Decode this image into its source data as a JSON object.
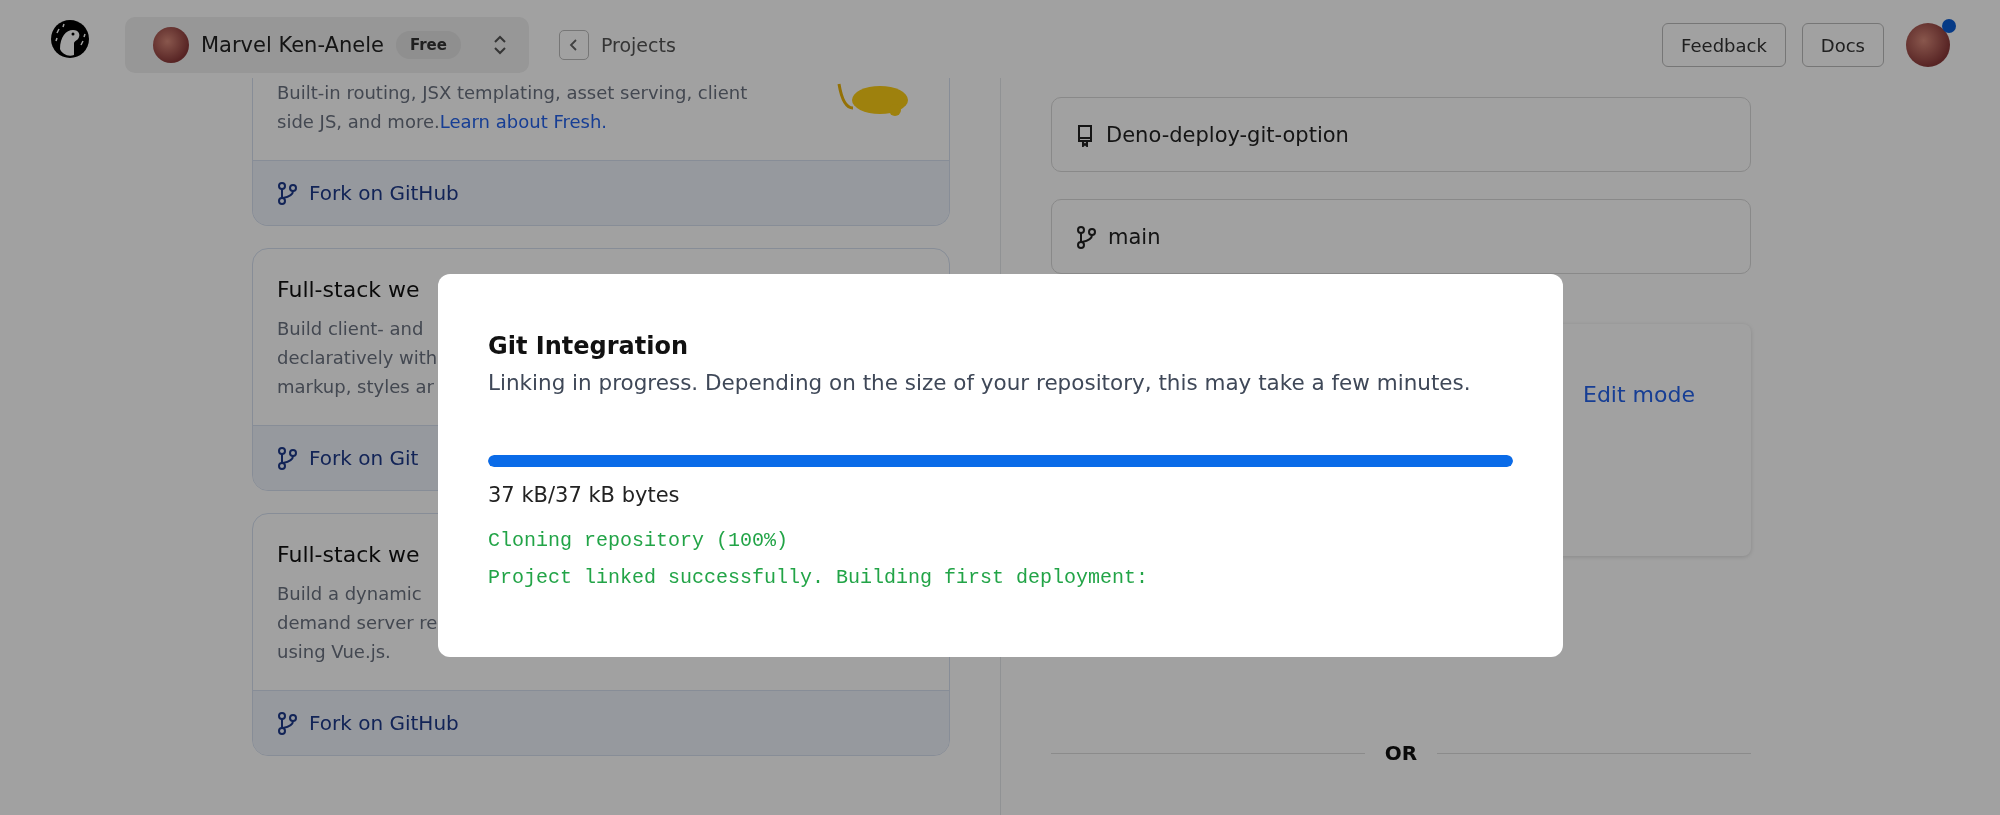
{
  "header": {
    "workspace": {
      "name": "Marvel Ken-Anele",
      "plan": "Free"
    },
    "breadcrumb": "Projects",
    "buttons": [
      "Feedback",
      "Docs"
    ],
    "notification": true
  },
  "templates": [
    {
      "description_lines": [
        "Built-in routing, JSX templating, asset serving, client",
        "side JS, and more."
      ],
      "link": "Learn about Fresh.",
      "action": "Fork on GitHub"
    },
    {
      "title": "Full-stack we",
      "description_lines": [
        "Build client- and",
        "declaratively with",
        "markup, styles ar"
      ],
      "action": "Fork on Git"
    },
    {
      "title": "Full-stack we",
      "description_lines": [
        "Build a dynamic",
        "demand server re",
        "using Vue.js."
      ],
      "action": "Fork on GitHub"
    }
  ],
  "git": {
    "repository": "Deno-deploy-git-option",
    "branch": "main",
    "edit_link": "Edit mode",
    "divider": "OR"
  },
  "modal": {
    "title": "Git Integration",
    "message": "Linking in progress. Depending on the size of your repository, this may take a few minutes.",
    "progress": {
      "level": 1,
      "reading": "37 kB/37 kB bytes"
    },
    "log": [
      "Cloning repository (100%)",
      "Project linked successfully. Building first deployment:"
    ]
  }
}
